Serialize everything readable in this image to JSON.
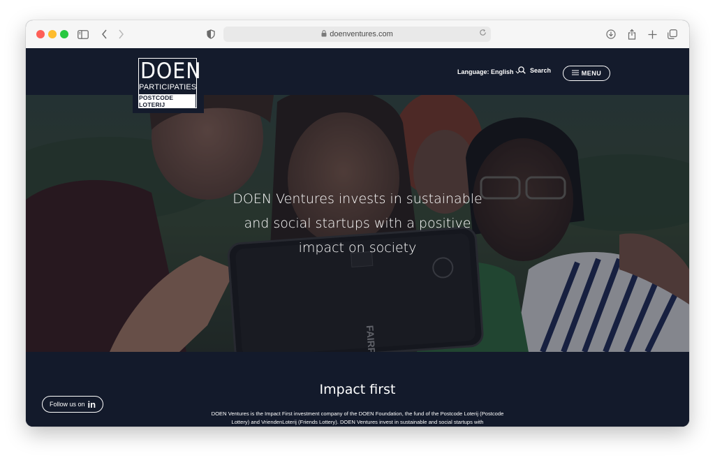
{
  "browser": {
    "url": "doenventures.com"
  },
  "header": {
    "logo": {
      "title": "DOEN",
      "subtitle": "PARTICIPATIES",
      "tagline": "POSTCODE LOTERIJ"
    },
    "language_label": "Language: English",
    "search_label": "Search",
    "menu_label": "MENU"
  },
  "hero": {
    "headline": "DOEN Ventures invests in sustainable and social startups with a positive impact on society"
  },
  "impact": {
    "title": "Impact first",
    "body": "DOEN Ventures is the Impact First investment company of the DOEN Foundation, the fund of the Postcode Loterij (Postcode Lottery) and VriendenLoterij (Friends Lottery). DOEN Ventures invest in sustainable and social startups with"
  },
  "social": {
    "follow_label": "Follow us on",
    "network_label": "in"
  },
  "colors": {
    "navy": "#131a2b",
    "white": "#ffffff"
  }
}
